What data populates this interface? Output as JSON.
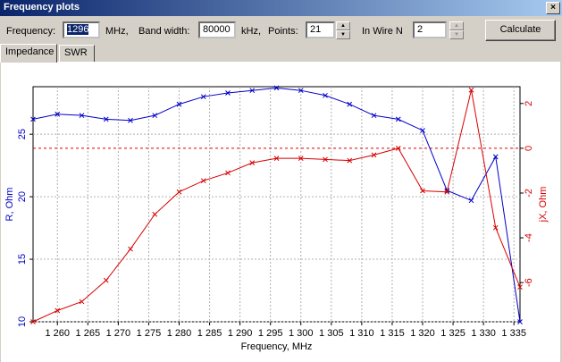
{
  "window": {
    "title": "Frequency plots",
    "close_label": "×"
  },
  "controls": {
    "frequency_label": "Frequency:",
    "frequency_value": "1296",
    "frequency_unit": "MHz,",
    "bandwidth_label": "Band width:",
    "bandwidth_value": "80000",
    "bandwidth_unit": "kHz,",
    "points_label": "Points:",
    "points_value": "21",
    "wire_label": "In Wire N",
    "wire_value": "2",
    "calculate_label": "Calculate",
    "spin_up": "▲",
    "spin_down": "▼"
  },
  "tabs": [
    {
      "label": "Impedance",
      "active": true
    },
    {
      "label": "SWR",
      "active": false
    }
  ],
  "chart_data": {
    "type": "line",
    "xlabel": "Frequency, MHz",
    "ylabel": "R, Ohm",
    "y2label": "jX, Ohm",
    "xlim": [
      1256,
      1336
    ],
    "ylim": [
      10,
      28.8
    ],
    "y2lim": [
      -7.75,
      2.75
    ],
    "x_ticks": [
      1260,
      1265,
      1270,
      1275,
      1280,
      1285,
      1290,
      1295,
      1300,
      1305,
      1310,
      1315,
      1320,
      1325,
      1330,
      1335
    ],
    "x_tick_labels": [
      "1 260",
      "1 265",
      "1 270",
      "1 275",
      "1 280",
      "1 285",
      "1 290",
      "1 295",
      "1 300",
      "1 305",
      "1 310",
      "1 315",
      "1 320",
      "1 325",
      "1 330",
      "1 335"
    ],
    "y_ticks": [
      10,
      15,
      20,
      25
    ],
    "y_tick_labels": [
      "10",
      "15",
      "20",
      "25"
    ],
    "y2_ticks": [
      2,
      0,
      -2,
      -4,
      -6
    ],
    "y2_tick_labels": [
      "2",
      "0",
      "-2",
      "-4",
      "-6"
    ],
    "grid": true,
    "reference_line": {
      "axis": "y2",
      "value": 0,
      "color": "#e00000"
    },
    "x": [
      1256,
      1260,
      1264,
      1268,
      1272,
      1276,
      1280,
      1284,
      1288,
      1292,
      1296,
      1300,
      1304,
      1308,
      1312,
      1316,
      1320,
      1324,
      1328,
      1332,
      1336
    ],
    "series": [
      {
        "axis": "y",
        "color": "#0000c8",
        "values": [
          26.2,
          26.6,
          26.5,
          26.2,
          26.1,
          26.5,
          27.4,
          28.0,
          28.3,
          28.5,
          28.7,
          28.5,
          28.1,
          27.4,
          26.5,
          26.2,
          25.3,
          20.5,
          19.7,
          23.2,
          10.0
        ]
      },
      {
        "axis": "y2",
        "color": "#d80000",
        "values": [
          -7.75,
          -7.25,
          -6.85,
          -5.9,
          -4.5,
          -2.95,
          -1.95,
          -1.45,
          -1.1,
          -0.65,
          -0.45,
          -0.45,
          -0.5,
          -0.55,
          -0.3,
          0.0,
          -1.9,
          -1.95,
          2.6,
          -3.55,
          -6.2
        ]
      }
    ]
  }
}
